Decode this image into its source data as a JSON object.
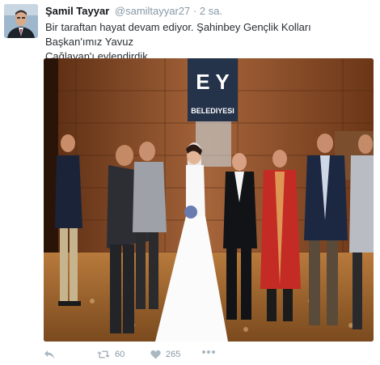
{
  "tweet": {
    "author_name": "Şamil Tayyar",
    "handle": "@samiltayyar27",
    "separator": "·",
    "time": "2 sa.",
    "text_line1": "Bir taraftan hayat devam ediyor. Şahinbey Gençlik Kolları Başkan'ımız Yavuz",
    "text_line2": "Çağlayan'ı evlendirdik.",
    "photo_sign": {
      "letters": "E Y",
      "word": "BELEDIYESI"
    },
    "actions": {
      "reply_icon": "reply-icon",
      "retweet_icon": "retweet-icon",
      "retweet_count": "60",
      "like_icon": "heart-icon",
      "like_count": "265",
      "more_icon": "more-dots-icon"
    }
  },
  "colors": {
    "name": "#14171a",
    "muted": "#8899a6",
    "text": "#292f33",
    "icon": "#aab8c2"
  }
}
